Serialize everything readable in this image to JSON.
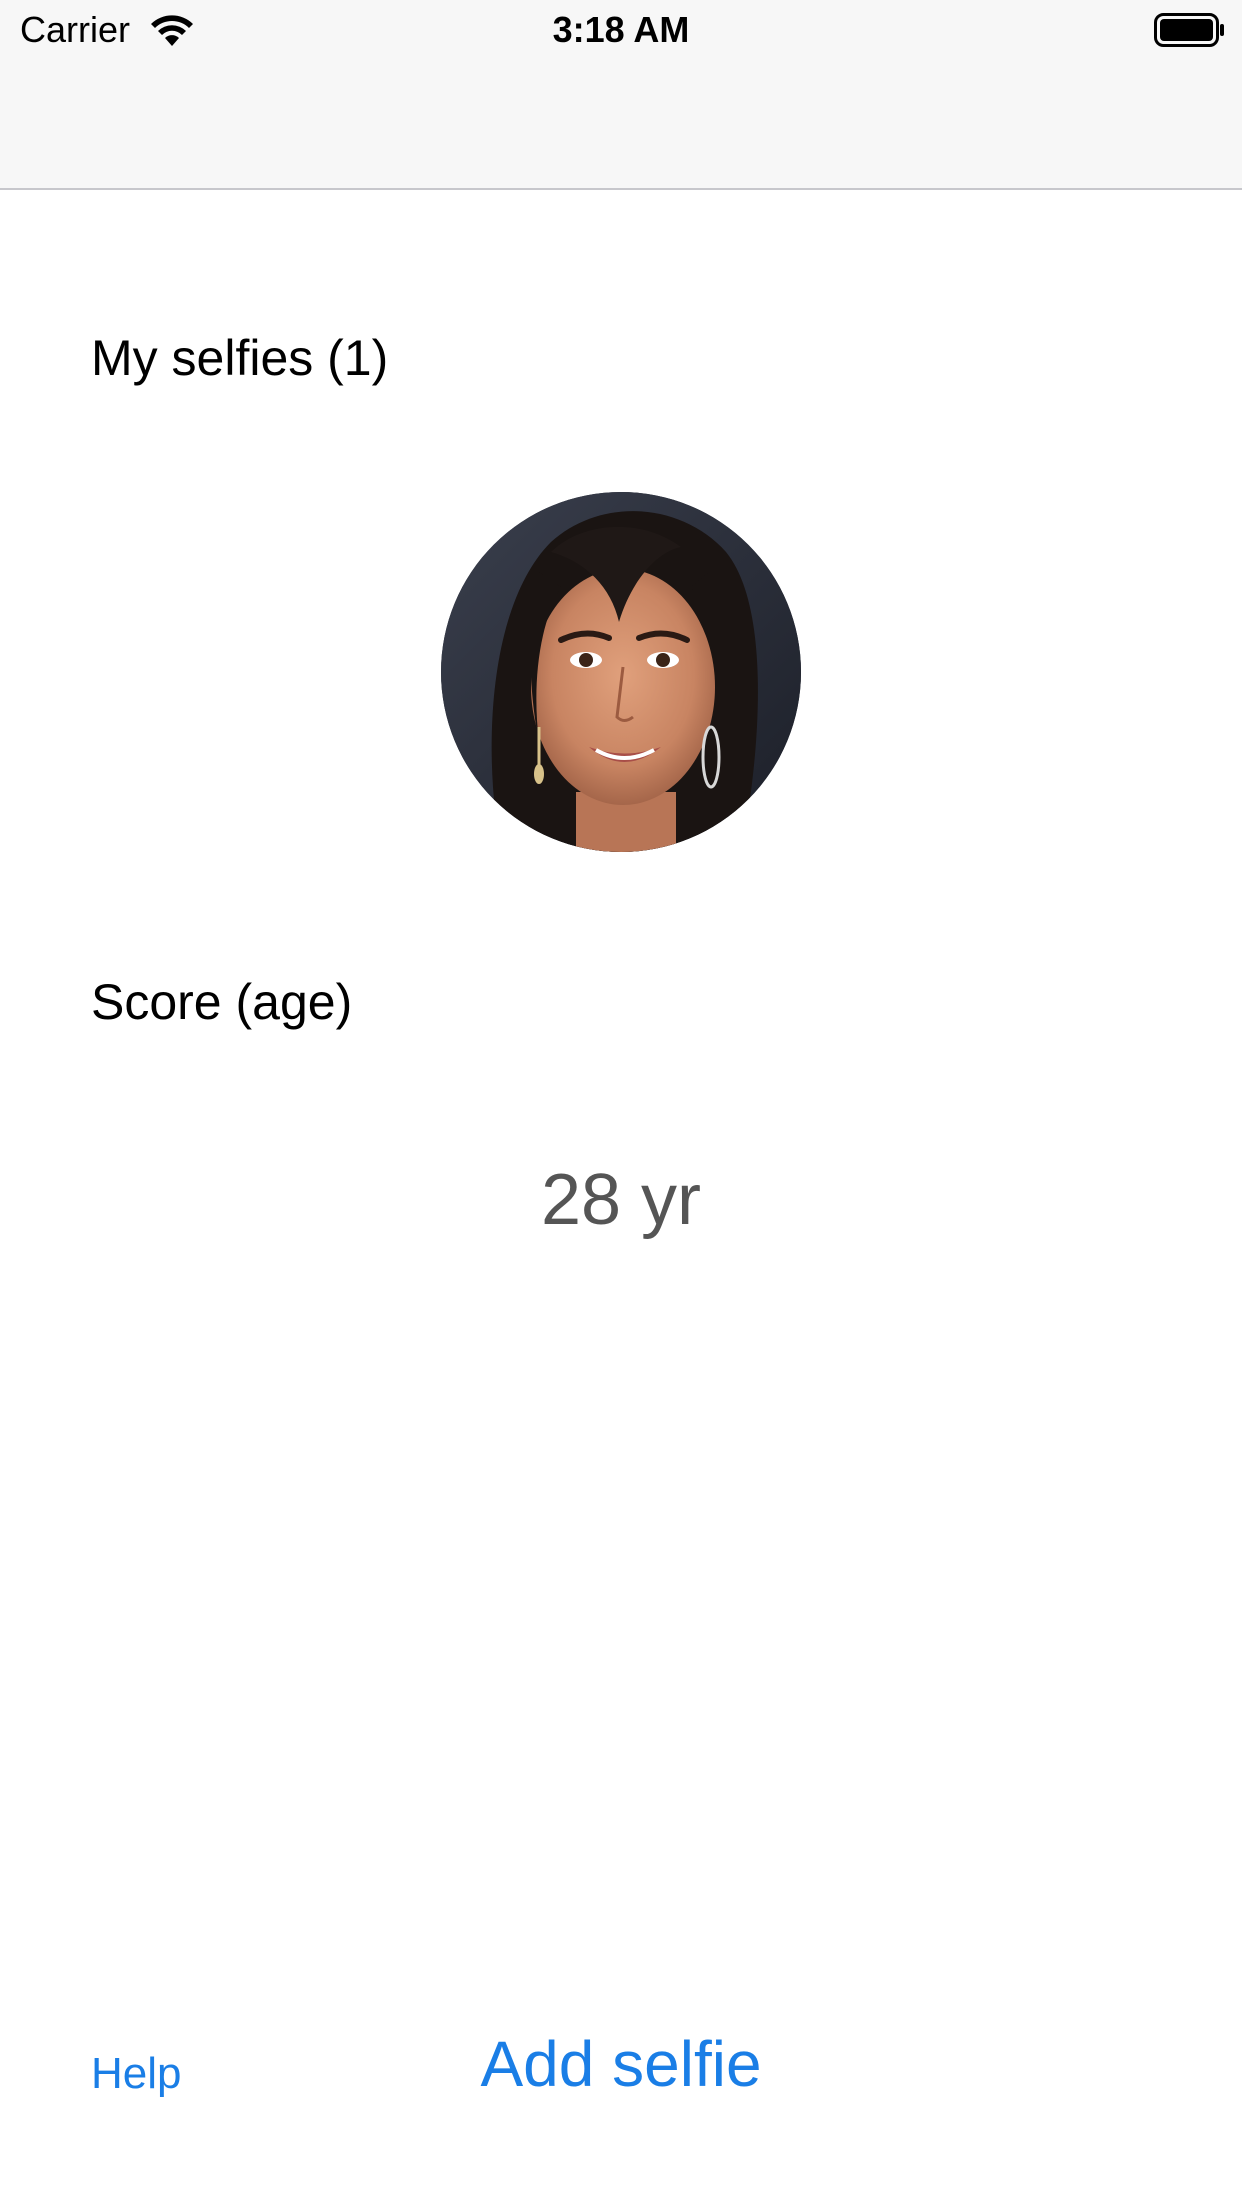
{
  "status_bar": {
    "carrier": "Carrier",
    "time": "3:18 AM"
  },
  "selfies": {
    "title": "My selfies (1)"
  },
  "score": {
    "title": "Score (age)",
    "value": "28 yr"
  },
  "footer": {
    "help_label": "Help",
    "add_label": "Add selfie"
  },
  "colors": {
    "accent": "#1a7ee6",
    "status_bar_bg": "#f7f7f7",
    "score_text": "#555555"
  },
  "icons": [
    "wifi-icon",
    "battery-icon"
  ]
}
